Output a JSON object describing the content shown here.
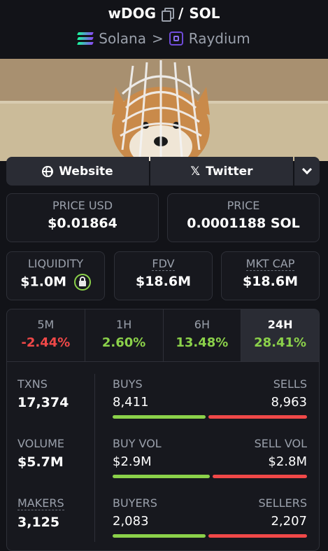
{
  "header": {
    "token": "wDOG",
    "separator": "/",
    "quote": "SOL",
    "chain": "Solana",
    "arrow": ">",
    "dex": "Raydium"
  },
  "links": {
    "website": "Website",
    "twitter": "Twitter"
  },
  "price": {
    "usd_label": "PRICE USD",
    "usd_value": "$0.01864",
    "native_label": "PRICE",
    "native_value": "0.0001188 SOL"
  },
  "metrics": {
    "liquidity_label": "LIQUIDITY",
    "liquidity_value": "$1.0M",
    "fdv_label": "FDV",
    "fdv_value": "$18.6M",
    "mktcap_label": "MKT CAP",
    "mktcap_value": "$18.6M"
  },
  "tabs": [
    {
      "label": "5M",
      "value": "-2.44%"
    },
    {
      "label": "1H",
      "value": "2.60%"
    },
    {
      "label": "6H",
      "value": "13.48%"
    },
    {
      "label": "24H",
      "value": "28.41%"
    }
  ],
  "stats": {
    "txns_label": "TXNS",
    "txns_value": "17,374",
    "buys_label": "BUYS",
    "buys_value": "8,411",
    "sells_label": "SELLS",
    "sells_value": "8,963",
    "buys_fraction": 0.484,
    "volume_label": "VOLUME",
    "volume_value": "$5.7M",
    "buyvol_label": "BUY VOL",
    "buyvol_value": "$2.9M",
    "sellvol_label": "SELL VOL",
    "sellvol_value": "$2.8M",
    "buyvol_fraction": 0.509,
    "makers_label": "MAKERS",
    "makers_value": "3,125",
    "buyers_label": "BUYERS",
    "buyers_value": "2,083",
    "sellers_label": "SELLERS",
    "sellers_value": "2,207",
    "buyers_fraction": 0.486
  },
  "colors": {
    "positive": "#8bd14a",
    "negative": "#f04848",
    "background": "#121318"
  }
}
